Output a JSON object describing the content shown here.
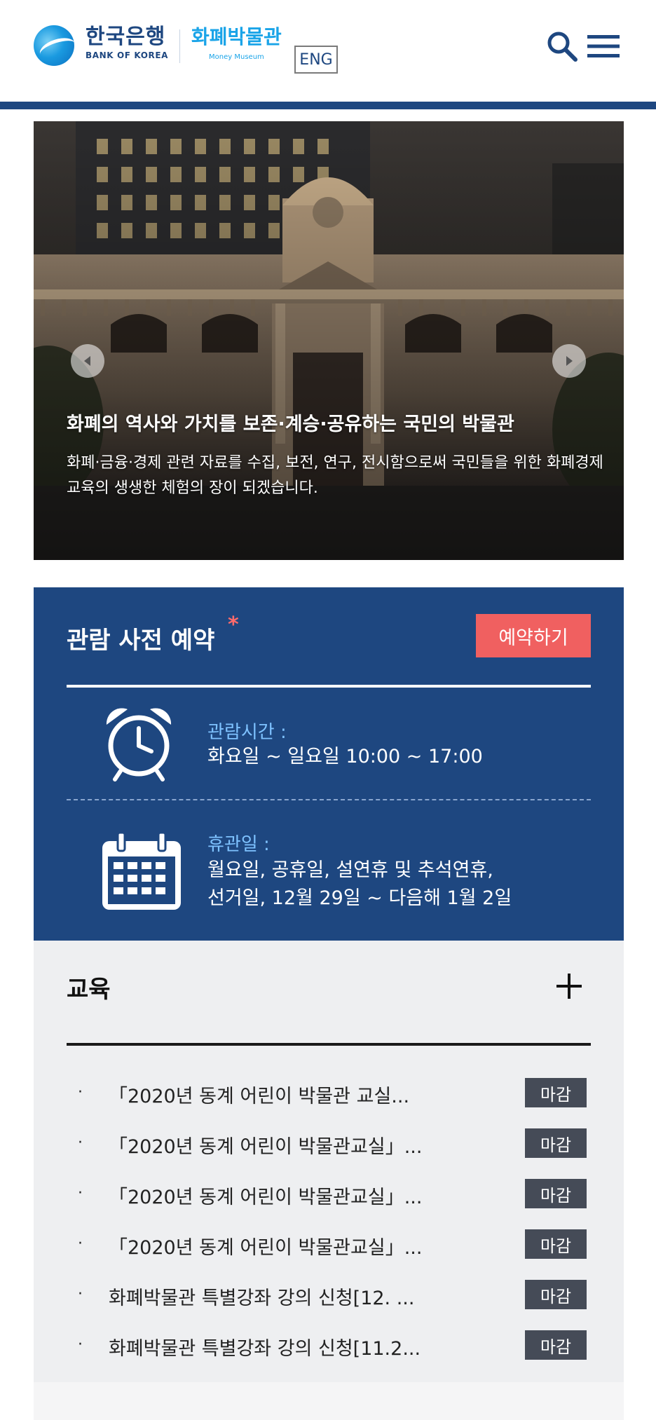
{
  "header": {
    "bank_name_kr": "한국은행",
    "bank_name_en": "BANK OF KOREA",
    "museum_name_kr": "화폐박물관",
    "museum_name_en": "Money Museum",
    "lang_button": "ENG",
    "accent_color": "#1e4780"
  },
  "hero": {
    "title": "화폐의 역사와 가치를 보존·계승·공유하는 국민의 박물관",
    "description": "화폐·금융·경제 관련 자료를 수집, 보전, 연구, 전시함으로써 국민들을 위한 화폐경제교육의 생생한 체험의 장이 되겠습니다."
  },
  "reservation": {
    "title": "관람 사전 예약",
    "required_mark": "*",
    "button": "예약하기",
    "hours_label": "관람시간 :",
    "hours_value": "화요일 ~ 일요일 10:00 ~ 17:00",
    "closed_label": "휴관일 :",
    "closed_value_line1": "월요일, 공휴일, 설연휴 및 추석연휴,",
    "closed_value_line2": "선거일, 12월 29일 ~ 다음해 1월 2일",
    "background_color": "#1e4780",
    "button_color": "#f06060"
  },
  "education": {
    "title": "교육",
    "items": [
      {
        "text": "「2020년 동계 어린이 박물관 교실...",
        "status": "마감"
      },
      {
        "text": "「2020년 동계 어린이 박물관교실」...",
        "status": "마감"
      },
      {
        "text": "「2020년 동계 어린이 박물관교실」...",
        "status": "마감"
      },
      {
        "text": "「2020년 동계 어린이 박물관교실」...",
        "status": "마감"
      },
      {
        "text": "화폐박물관 특별강좌 강의 신청[12. ...",
        "status": "마감"
      },
      {
        "text": "화폐박물관 특별강좌 강의 신청[11.2...",
        "status": "마감"
      }
    ]
  }
}
